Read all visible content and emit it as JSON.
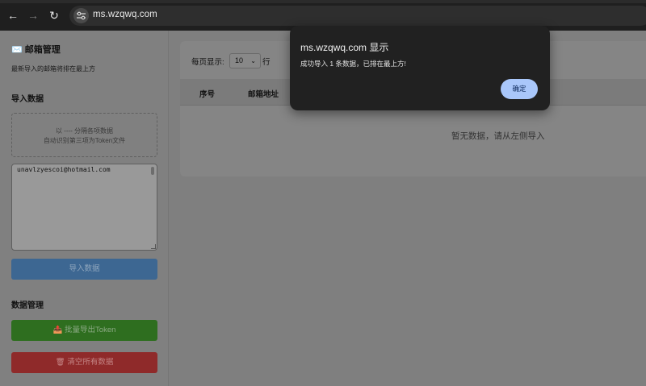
{
  "browser": {
    "url": "ms.wzqwq.com",
    "back_icon": "arrow-left-icon",
    "forward_icon": "arrow-right-icon",
    "reload_icon": "reload-icon"
  },
  "sidebar": {
    "title": "✉️ 邮箱管理",
    "subtitle": "最新导入的邮箱将排在最上方",
    "import_heading": "导入数据",
    "dropzone_line1": "以 ---- 分隔各项数据",
    "dropzone_line2": "自动识别第三项为Token文件",
    "textarea_value": "unavlzyescoi@hotmail.com",
    "import_button": "导入数据",
    "manage_heading": "数据管理",
    "export_button": "📤 批量导出Token",
    "clear_button": "🗑 清空所有数据"
  },
  "main": {
    "per_page_label": "每页显示:",
    "per_page_value": "10",
    "per_page_unit": "行",
    "columns": [
      "序号",
      "邮箱地址"
    ],
    "empty_text": "暂无数据，请从左侧导入"
  },
  "dialog": {
    "title": "ms.wzqwq.com 显示",
    "message": "成功导入 1 条数据，已排在最上方!",
    "ok_button": "确定"
  }
}
